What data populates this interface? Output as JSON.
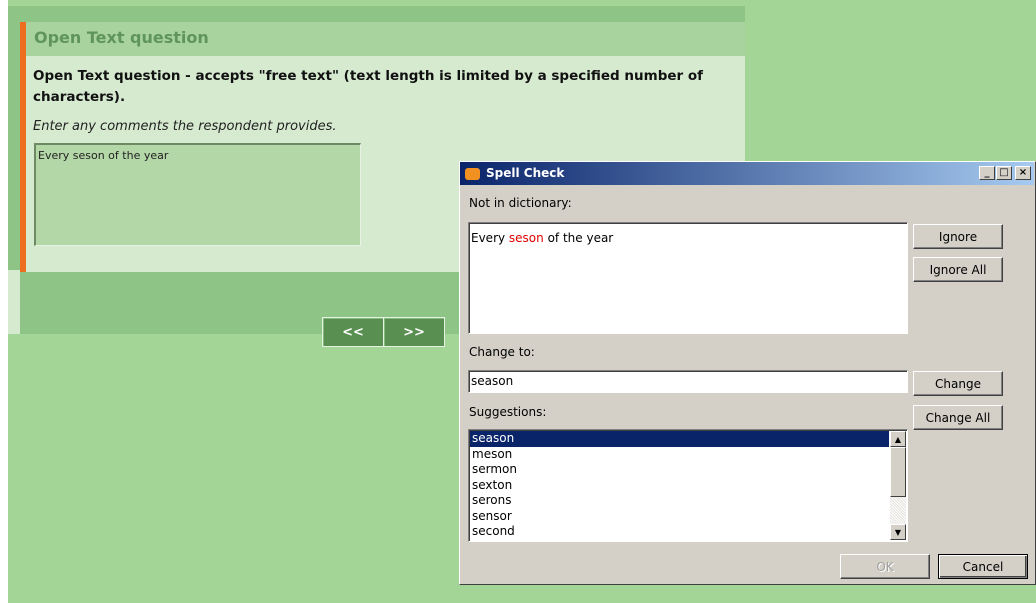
{
  "survey": {
    "question_title": "Open Text question",
    "question_text": "Open Text question - accepts \"free text\" (text length is limited by a specified number of characters).",
    "hint": "Enter any comments the respondent provides.",
    "answer_value": "Every seson of the year",
    "prev_label": "<<",
    "next_label": ">>"
  },
  "dialog": {
    "title": "Spell Check",
    "minimize_glyph": "_",
    "maximize_glyph": "□",
    "close_glyph": "×",
    "not_in_dictionary_label": "Not in dictionary:",
    "context_before": "Every ",
    "misspelled_word": "seson",
    "context_after": " of the year",
    "change_to_label": "Change to:",
    "change_to_value": "season",
    "suggestions_label": "Suggestions:",
    "suggestions": [
      "season",
      "meson",
      "sermon",
      "sexton",
      "serons",
      "sensor",
      "second"
    ],
    "selected_suggestion": "season",
    "buttons": {
      "ignore": "Ignore",
      "ignore_all": "Ignore All",
      "change": "Change",
      "change_all": "Change All",
      "ok": "OK",
      "cancel": "Cancel"
    },
    "scroll_up_glyph": "▲",
    "scroll_down_glyph": "▼"
  },
  "colors": {
    "page_green": "#a3d596",
    "dark_green": "#8fc487",
    "accent_orange": "#ed6e1e",
    "title_bar_navy": "#0a246a",
    "misspelling_red": "#e00000"
  }
}
